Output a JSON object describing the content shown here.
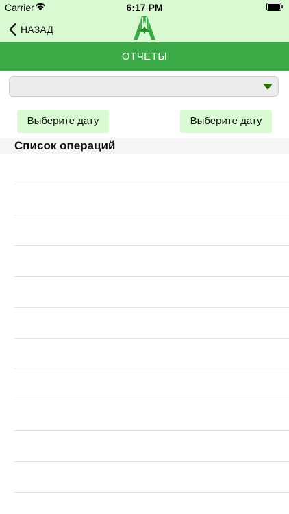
{
  "status_bar": {
    "carrier": "Carrier",
    "time": "6:17 PM"
  },
  "nav": {
    "back_label": "НАЗАД",
    "logo_icon": "aviation-logo-icon"
  },
  "title": "ОТЧЕТЫ",
  "select": {
    "value": ""
  },
  "date_from": {
    "label": "Выберите дату"
  },
  "date_to": {
    "label": "Выберите дату"
  },
  "section": {
    "title": "Список операций"
  },
  "colors": {
    "header_bg": "#d9f9d3",
    "accent_green": "#3daa48",
    "button_bg": "#d9f9d3",
    "select_bg": "#ececec"
  }
}
